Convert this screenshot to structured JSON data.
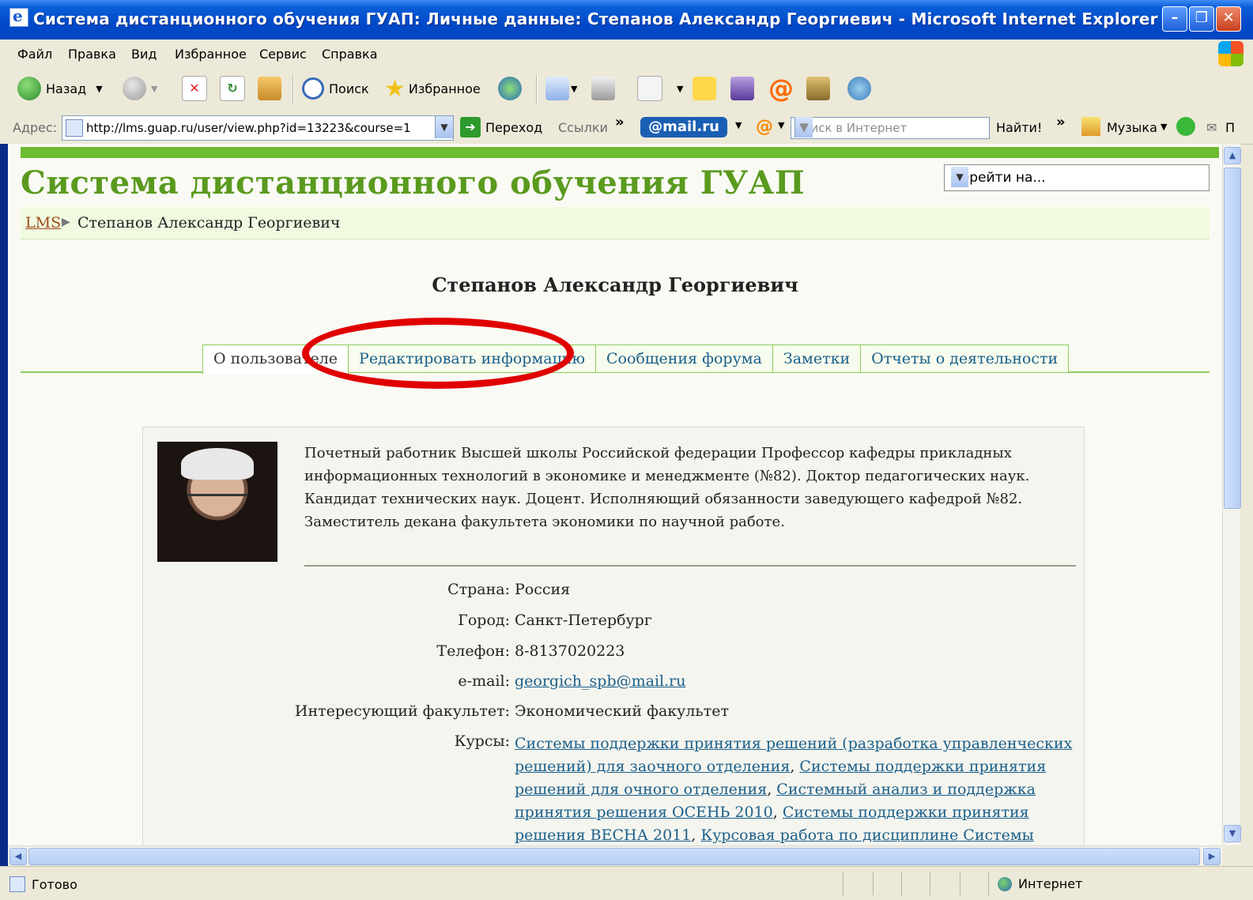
{
  "window": {
    "title": "Система дистанционного обучения ГУАП: Личные данные: Степанов Александр Георгиевич - Microsoft Internet Explorer",
    "buttons": {
      "minimize": "–",
      "maximize": "❐",
      "close": "✕"
    }
  },
  "menu": [
    "Файл",
    "Правка",
    "Вид",
    "Избранное",
    "Сервис",
    "Справка"
  ],
  "toolbar": {
    "back": "Назад",
    "search": "Поиск",
    "favorites": "Избранное"
  },
  "address": {
    "label": "Адрес:",
    "url": "http://lms.guap.ru/user/view.php?id=13223&course=1",
    "go": "Переход",
    "links": "Ссылки",
    "mailru": "@mail.ru",
    "search_placeholder": "Поиск в Интернет",
    "find": "Найти!",
    "music": "Музыка",
    "more": "»",
    "trailing": "П"
  },
  "page": {
    "site_title": "Система дистанционного обучения ГУАП",
    "jump_select": "Перейти на...",
    "breadcrumb_home": "LMS",
    "breadcrumb_current": "Степанов Александр Георгиевич",
    "full_name": "Степанов Александр Георгиевич",
    "tabs": [
      {
        "label": "О пользователе",
        "active": true
      },
      {
        "label": "Редактировать информацию",
        "active": false
      },
      {
        "label": "Сообщения форума",
        "active": false
      },
      {
        "label": "Заметки",
        "active": false
      },
      {
        "label": "Отчеты о деятельности",
        "active": false
      }
    ],
    "bio": "Почетный работник Высшей школы Российской федерации Профессор кафедры прикладных информационных технологий в экономике и менеджменте (№82). Доктор педагогических наук. Кандидат технических наук. Доцент. Исполняющий обязанности заведующего кафедрой №82. Заместитель декана факультета экономики по научной работе.",
    "fields": {
      "country_label": "Страна:",
      "country": "Россия",
      "city_label": "Город:",
      "city": "Санкт-Петербург",
      "phone_label": "Телефон:",
      "phone": "8-8137020223",
      "email_label": "e-mail:",
      "email": "georgich_spb@mail.ru",
      "faculty_label": "Интересующий факультет:",
      "faculty": "Экономический факультет",
      "courses_label": "Курсы:"
    },
    "courses": [
      "Системы поддержки принятия решений (разработка управленческих решений) для заочного отделения",
      "Системы поддержки принятия решений для очного отделения",
      "Системный анализ и поддержка принятия решения ОСЕНЬ 2010",
      "Системы поддержки принятия решения ВЕСНА 2011",
      "Курсовая работа по дисциплине Системы поддержки принятия решения"
    ]
  },
  "status": {
    "left": "Готово",
    "zone": "Интернет"
  },
  "colors": {
    "accent_green": "#6dbb30",
    "title_green": "#5a9a1e",
    "link_blue": "#1a5f8a",
    "annotation_red": "#e00000",
    "xp_blue": "#0049c8"
  }
}
